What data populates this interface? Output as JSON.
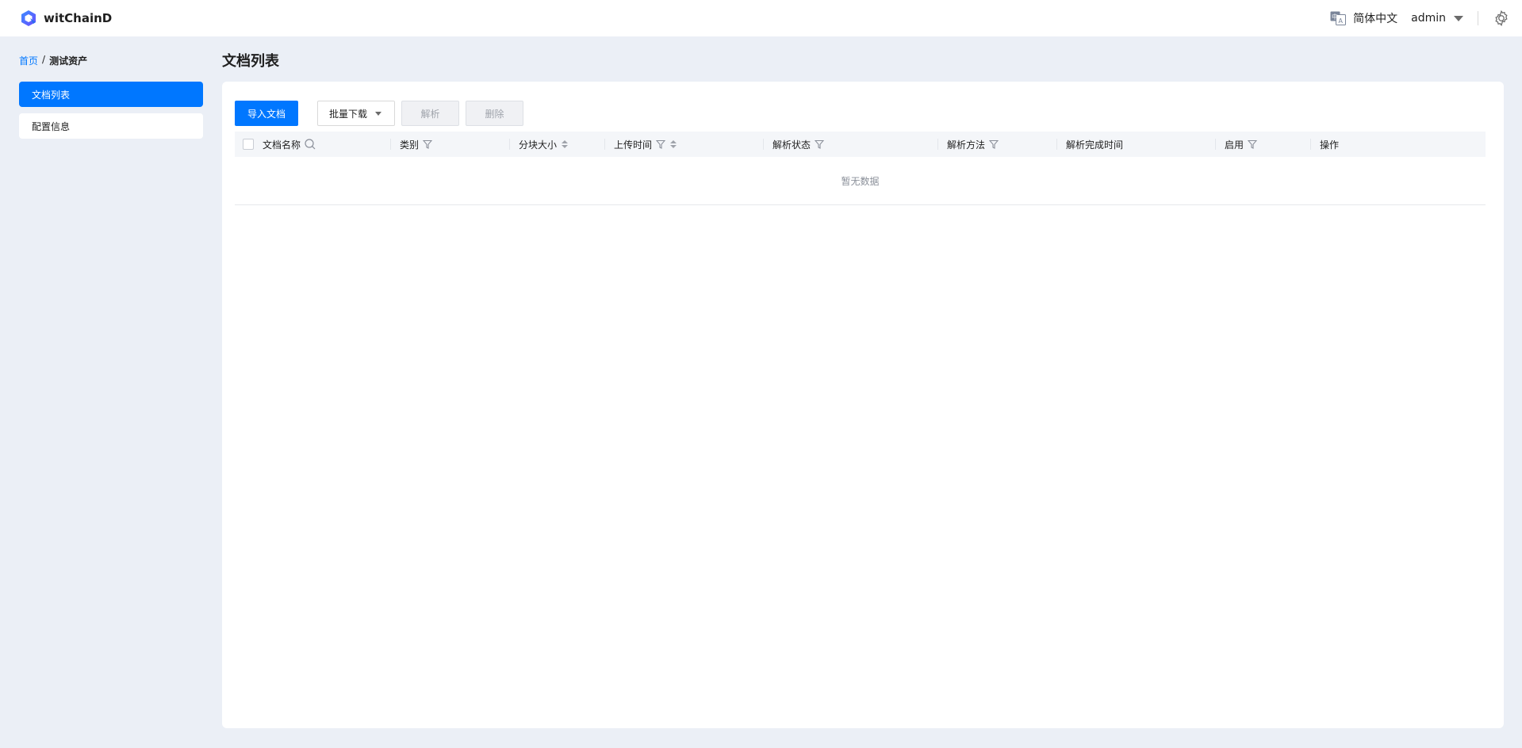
{
  "header": {
    "app_name": "witChainD",
    "language": "简体中文",
    "user": "admin"
  },
  "breadcrumb": {
    "home": "首页",
    "separator": "/",
    "current": "测试资产"
  },
  "sidebar": {
    "items": [
      {
        "label": "文档列表",
        "active": true
      },
      {
        "label": "配置信息",
        "active": false
      }
    ]
  },
  "page": {
    "title": "文档列表"
  },
  "toolbar": {
    "import_label": "导入文档",
    "batch_download_label": "批量下载",
    "parse_label": "解析",
    "delete_label": "删除"
  },
  "table": {
    "columns": [
      {
        "label": "文档名称",
        "icon": "search-icon"
      },
      {
        "label": "类别",
        "icon": "filter-icon"
      },
      {
        "label": "分块大小",
        "icon": "sort-icon"
      },
      {
        "label": "上传时间",
        "icon": "filter-sort-icon"
      },
      {
        "label": "解析状态",
        "icon": "filter-icon"
      },
      {
        "label": "解析方法",
        "icon": "filter-icon"
      },
      {
        "label": "解析完成时间",
        "icon": ""
      },
      {
        "label": "启用",
        "icon": "filter-icon"
      },
      {
        "label": "操作",
        "icon": ""
      }
    ],
    "empty_text": "暂无数据"
  },
  "colors": {
    "accent": "#0077FF",
    "background": "#EBEFF6",
    "disabled_bg": "#F0F1F4"
  }
}
